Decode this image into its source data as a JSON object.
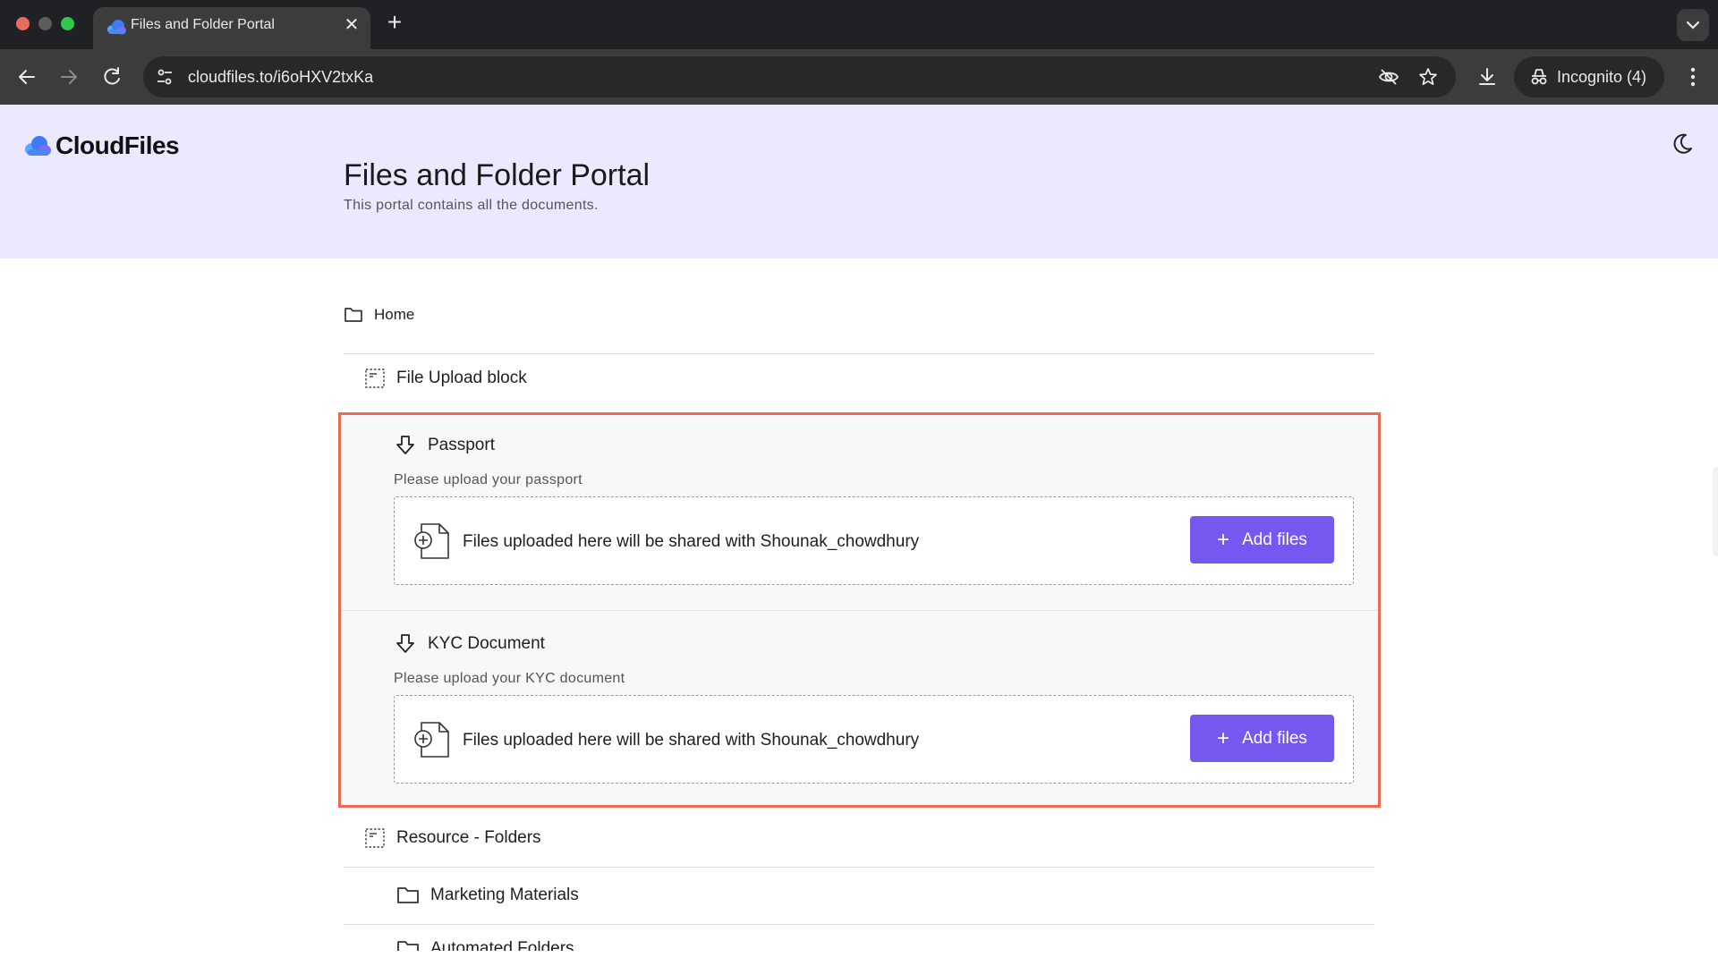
{
  "browser": {
    "tab_title": "Files and Folder Portal",
    "new_tab_icon": "plus-icon",
    "url": "cloudfiles.to/i6oHXV2txKa",
    "incognito_label": "Incognito (4)"
  },
  "header": {
    "logo_text": "CloudFiles",
    "title": "Files and Folder Portal",
    "subtitle": "This portal contains all the documents."
  },
  "breadcrumb": {
    "home": "Home"
  },
  "file_upload_block": {
    "label": "File Upload block",
    "items": [
      {
        "title": "Passport",
        "description": "Please upload your passport",
        "dropzone_text": "Files uploaded here will be shared with Shounak_chowdhury",
        "button_label": "Add files"
      },
      {
        "title": "KYC Document",
        "description": "Please upload your KYC document",
        "dropzone_text": "Files uploaded here will be shared with Shounak_chowdhury",
        "button_label": "Add files"
      }
    ]
  },
  "resource_block": {
    "label": "Resource - Folders",
    "folders": [
      {
        "name": "Marketing Materials"
      },
      {
        "name": "Automated Folders"
      }
    ]
  },
  "colors": {
    "accent": "#7558ef",
    "highlight_border": "#ec6a54",
    "hero_background": "#ebe9fe"
  }
}
